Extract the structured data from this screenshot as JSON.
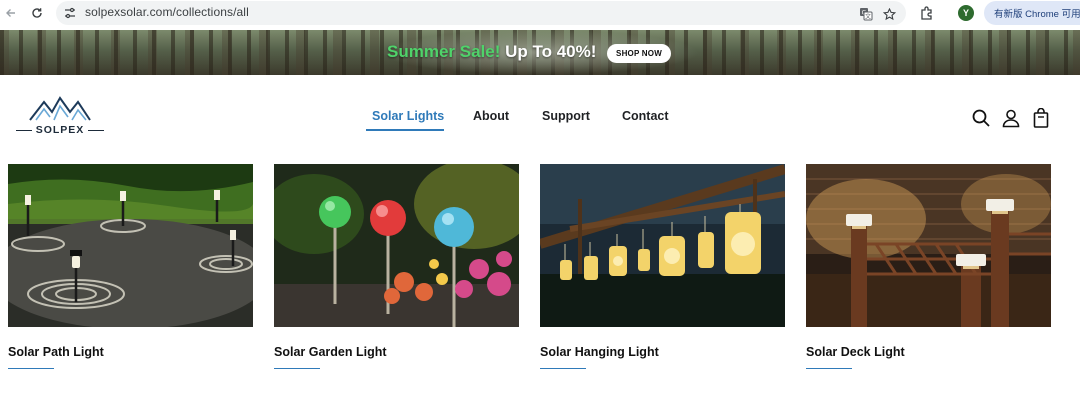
{
  "browser": {
    "url": "solpexsolar.com/collections/all",
    "profile_initial": "Y",
    "update_label": "有新版 Chrome 可用",
    "icons": [
      "back-arrow-icon",
      "reload-icon",
      "site-settings-icon",
      "translate-icon",
      "bookmark-star-icon",
      "extensions-icon"
    ]
  },
  "banner": {
    "highlight": "Summer Sale!",
    "rest": " Up To 40%!",
    "button": "SHOP NOW"
  },
  "header": {
    "logo_text": "SOLPEX",
    "nav": [
      {
        "label": "Solar Lights",
        "active": true
      },
      {
        "label": "About",
        "active": false
      },
      {
        "label": "Support",
        "active": false
      },
      {
        "label": "Contact",
        "active": false
      }
    ],
    "icons": [
      "search-icon",
      "account-icon",
      "cart-icon"
    ]
  },
  "products": [
    {
      "title": "Solar Path Light"
    },
    {
      "title": "Solar Garden Light"
    },
    {
      "title": "Solar Hanging Light"
    },
    {
      "title": "Solar Deck Light"
    }
  ],
  "colors": {
    "accent": "#2f7ab9",
    "sale_green": "#4fd36a"
  }
}
